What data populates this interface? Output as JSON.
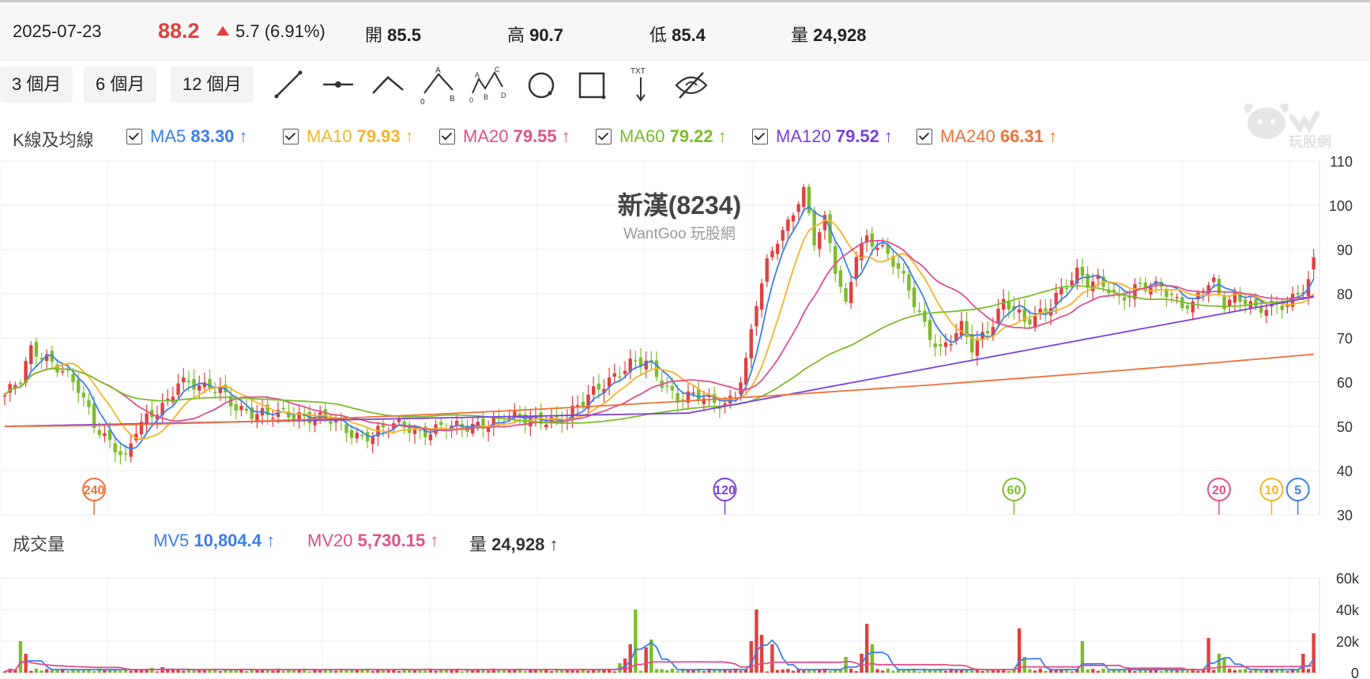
{
  "quote": {
    "date": "2025-07-23",
    "price": "88.2",
    "change": "5.7 (6.91%)",
    "open_label": "開",
    "open": "85.5",
    "high_label": "高",
    "high": "90.7",
    "low_label": "低",
    "low": "85.4",
    "volume_label": "量",
    "volume": "24,928"
  },
  "ranges": [
    "3 個月",
    "6 個月",
    "12 個月"
  ],
  "tools": [
    "line-tool-icon",
    "horizontal-line-tool-icon",
    "angle-tool-icon",
    "abc-pattern-tool-icon",
    "abcd-pattern-tool-icon",
    "circle-tool-icon",
    "rectangle-tool-icon",
    "text-arrow-tool-icon",
    "hide-drawings-icon"
  ],
  "tool_text": {
    "txt": "TXT"
  },
  "ma_header": {
    "title": "K線及均線",
    "items": [
      {
        "name": "MA5",
        "value": "83.30",
        "arrow": "↑",
        "color": "#3b7ee8"
      },
      {
        "name": "MA10",
        "value": "79.93",
        "arrow": "↑",
        "color": "#f5b428"
      },
      {
        "name": "MA20",
        "value": "79.55",
        "arrow": "↑",
        "color": "#e0508a"
      },
      {
        "name": "MA60",
        "value": "79.22",
        "arrow": "↑",
        "color": "#7cbc2a"
      },
      {
        "name": "MA120",
        "value": "79.52",
        "arrow": "↑",
        "color": "#7a3fe0"
      },
      {
        "name": "MA240",
        "value": "66.31",
        "arrow": "↑",
        "color": "#f07038"
      }
    ]
  },
  "logo": {
    "text": "玩股網"
  },
  "chart_title": "新漢(8234)",
  "chart_subtitle": "WantGoo 玩股網",
  "volume_header": {
    "title": "成交量",
    "items": [
      {
        "name": "MV5",
        "value": "10,804.4",
        "arrow": "↑",
        "color": "#3b7ee8"
      },
      {
        "name": "MV20",
        "value": "5,730.15",
        "arrow": "↑",
        "color": "#e0508a"
      },
      {
        "name": "量",
        "value": "24,928",
        "arrow": "↑",
        "color": "#333333"
      }
    ]
  },
  "colors": {
    "up": "#e0403f",
    "down": "#7cbc2a",
    "grid": "#eeeeee",
    "text": "#333333"
  },
  "chart_data": [
    {
      "type": "candlestick",
      "title": "新漢(8234)",
      "subtitle": "WantGoo 玩股網",
      "yticks": [
        "110",
        "100",
        "90",
        "80",
        "70",
        "60",
        "50",
        "40",
        "30"
      ],
      "ylim": [
        30,
        110
      ],
      "n_bars": 250,
      "period_markers": [
        {
          "label": "240",
          "color": "#f07038",
          "bar": 17
        },
        {
          "label": "120",
          "color": "#7a3fe0",
          "bar": 137
        },
        {
          "label": "60",
          "color": "#7cbc2a",
          "bar": 192
        },
        {
          "label": "20",
          "color": "#e0508a",
          "bar": 231
        },
        {
          "label": "10",
          "color": "#f5b428",
          "bar": 241
        },
        {
          "label": "5",
          "color": "#3b7ee8",
          "bar": 246
        }
      ],
      "close_keypoints": [
        [
          0,
          57
        ],
        [
          3,
          60
        ],
        [
          5,
          67
        ],
        [
          8,
          66
        ],
        [
          11,
          63
        ],
        [
          14,
          58
        ],
        [
          17,
          50
        ],
        [
          19,
          48
        ],
        [
          21,
          46
        ],
        [
          23,
          43
        ],
        [
          25,
          49
        ],
        [
          28,
          52
        ],
        [
          31,
          56
        ],
        [
          33,
          61
        ],
        [
          35,
          60
        ],
        [
          38,
          58
        ],
        [
          41,
          58
        ],
        [
          44,
          55
        ],
        [
          47,
          53
        ],
        [
          50,
          52
        ],
        [
          53,
          53
        ],
        [
          56,
          53
        ],
        [
          59,
          52
        ],
        [
          62,
          51
        ],
        [
          65,
          49
        ],
        [
          68,
          48
        ],
        [
          71,
          49
        ],
        [
          75,
          50
        ],
        [
          79,
          49
        ],
        [
          83,
          50
        ],
        [
          87,
          49
        ],
        [
          91,
          51
        ],
        [
          95,
          52
        ],
        [
          99,
          51
        ],
        [
          103,
          52
        ],
        [
          107,
          52
        ],
        [
          110,
          55
        ],
        [
          113,
          59
        ],
        [
          116,
          62
        ],
        [
          119,
          64
        ],
        [
          122,
          64
        ],
        [
          125,
          60
        ],
        [
          128,
          57
        ],
        [
          131,
          57
        ],
        [
          134,
          55
        ],
        [
          137,
          55
        ],
        [
          139,
          58
        ],
        [
          141,
          65
        ],
        [
          143,
          78
        ],
        [
          145,
          86
        ],
        [
          147,
          92
        ],
        [
          149,
          96
        ],
        [
          151,
          102
        ],
        [
          152,
          104
        ],
        [
          154,
          92
        ],
        [
          156,
          96
        ],
        [
          158,
          85
        ],
        [
          160,
          77
        ],
        [
          162,
          90
        ],
        [
          164,
          93
        ],
        [
          166,
          91
        ],
        [
          168,
          88
        ],
        [
          170,
          85
        ],
        [
          172,
          81
        ],
        [
          174,
          76
        ],
        [
          176,
          71
        ],
        [
          178,
          67
        ],
        [
          180,
          69
        ],
        [
          182,
          72
        ],
        [
          184,
          68
        ],
        [
          186,
          71
        ],
        [
          188,
          74
        ],
        [
          190,
          78
        ],
        [
          192,
          76
        ],
        [
          194,
          73
        ],
        [
          196,
          75
        ],
        [
          198,
          77
        ],
        [
          200,
          80
        ],
        [
          202,
          82
        ],
        [
          204,
          84
        ],
        [
          206,
          82
        ],
        [
          208,
          83
        ],
        [
          210,
          82
        ],
        [
          212,
          79
        ],
        [
          214,
          80
        ],
        [
          216,
          81
        ],
        [
          218,
          81
        ],
        [
          220,
          82
        ],
        [
          222,
          80
        ],
        [
          224,
          78
        ],
        [
          226,
          77
        ],
        [
          228,
          81
        ],
        [
          230,
          82
        ],
        [
          232,
          78
        ],
        [
          234,
          80
        ],
        [
          236,
          79
        ],
        [
          238,
          76
        ],
        [
          240,
          76
        ],
        [
          242,
          77
        ],
        [
          244,
          78
        ],
        [
          246,
          81
        ],
        [
          248,
          83
        ],
        [
          249,
          88.2
        ]
      ],
      "moving_averages": [
        {
          "name": "MA5",
          "last": 83.3
        },
        {
          "name": "MA10",
          "last": 79.93
        },
        {
          "name": "MA20",
          "last": 79.55
        },
        {
          "name": "MA60",
          "last": 79.22
        },
        {
          "name": "MA120",
          "last": 79.52
        },
        {
          "name": "MA240",
          "last": 66.31
        }
      ]
    },
    {
      "type": "bar",
      "title": "成交量",
      "yticks": [
        "60k",
        "40k",
        "20k",
        "0"
      ],
      "ylim": [
        0,
        60000
      ],
      "last_volume": 24928,
      "spikes": [
        [
          3,
          20000
        ],
        [
          4,
          12000
        ],
        [
          28,
          3000
        ],
        [
          30,
          3500
        ],
        [
          117,
          6000
        ],
        [
          118,
          9000
        ],
        [
          119,
          18000
        ],
        [
          120,
          40000
        ],
        [
          122,
          16000
        ],
        [
          123,
          21000
        ],
        [
          142,
          20000
        ],
        [
          143,
          40000
        ],
        [
          144,
          24000
        ],
        [
          146,
          18000
        ],
        [
          160,
          10000
        ],
        [
          163,
          12000
        ],
        [
          164,
          31000
        ],
        [
          165,
          18000
        ],
        [
          193,
          28000
        ],
        [
          194,
          10000
        ],
        [
          205,
          20000
        ],
        [
          229,
          22000
        ],
        [
          231,
          12000
        ],
        [
          232,
          9000
        ],
        [
          247,
          12000
        ],
        [
          249,
          24928
        ]
      ],
      "series": [
        {
          "name": "MV5"
        },
        {
          "name": "MV20"
        }
      ]
    }
  ]
}
